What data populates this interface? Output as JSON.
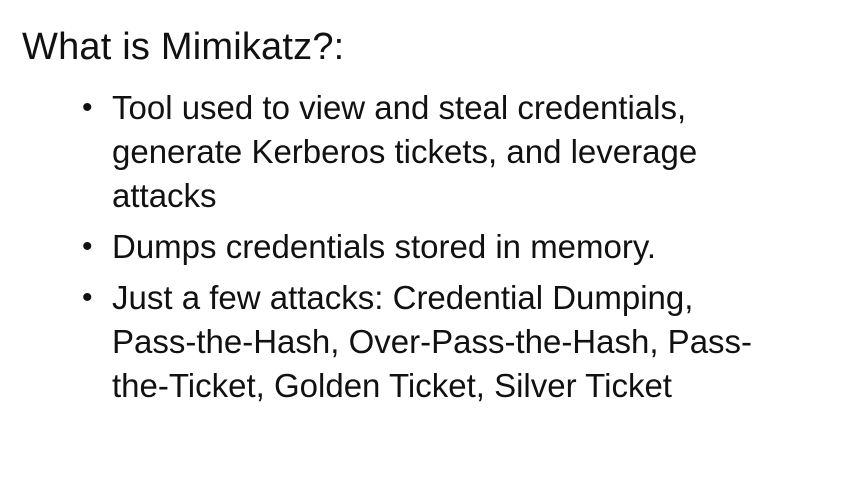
{
  "slide": {
    "title": "What is Mimikatz?:",
    "bullet_glyph": "•",
    "bullets": [
      {
        "lines": [
          "Tool used to view and steal credentials,",
          "generate Kerberos tickets, and leverage",
          "attacks"
        ]
      },
      {
        "lines": [
          "Dumps credentials stored in memory."
        ]
      },
      {
        "lines": [
          "Just a few attacks: Credential Dumping,",
          "Pass-the-Hash, Over-Pass-the-Hash, Pass-",
          "the-Ticket, Golden Ticket, Silver Ticket"
        ]
      }
    ]
  }
}
